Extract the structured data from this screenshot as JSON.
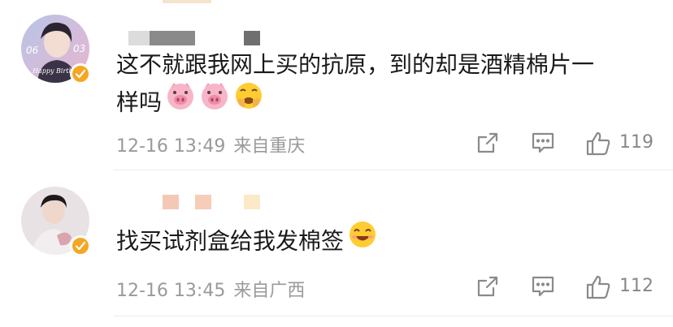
{
  "colors": {
    "text": "#1a1a1a",
    "meta": "#9a9a9a",
    "verified_badge": "#f5a623",
    "divider": "#ececec"
  },
  "comments": [
    {
      "text_lines": [
        "这不就跟我网上买的抗原，到的却是酒精棉片一",
        "样吗"
      ],
      "emojis": [
        "pig-face-icon",
        "pig-face-icon",
        "scared-face-icon"
      ],
      "timestamp": "12-16 13:49",
      "location": "来自重庆",
      "likes": "119",
      "avatar_text": {
        "left": "06",
        "right": "03",
        "script": "Happy Birthday"
      }
    },
    {
      "text_lines": [
        "找买试剂盒给我发棉签"
      ],
      "emojis": [
        "grinning-face-icon"
      ],
      "timestamp": "12-16 13:45",
      "location": "来自广西",
      "likes": "112"
    }
  ]
}
